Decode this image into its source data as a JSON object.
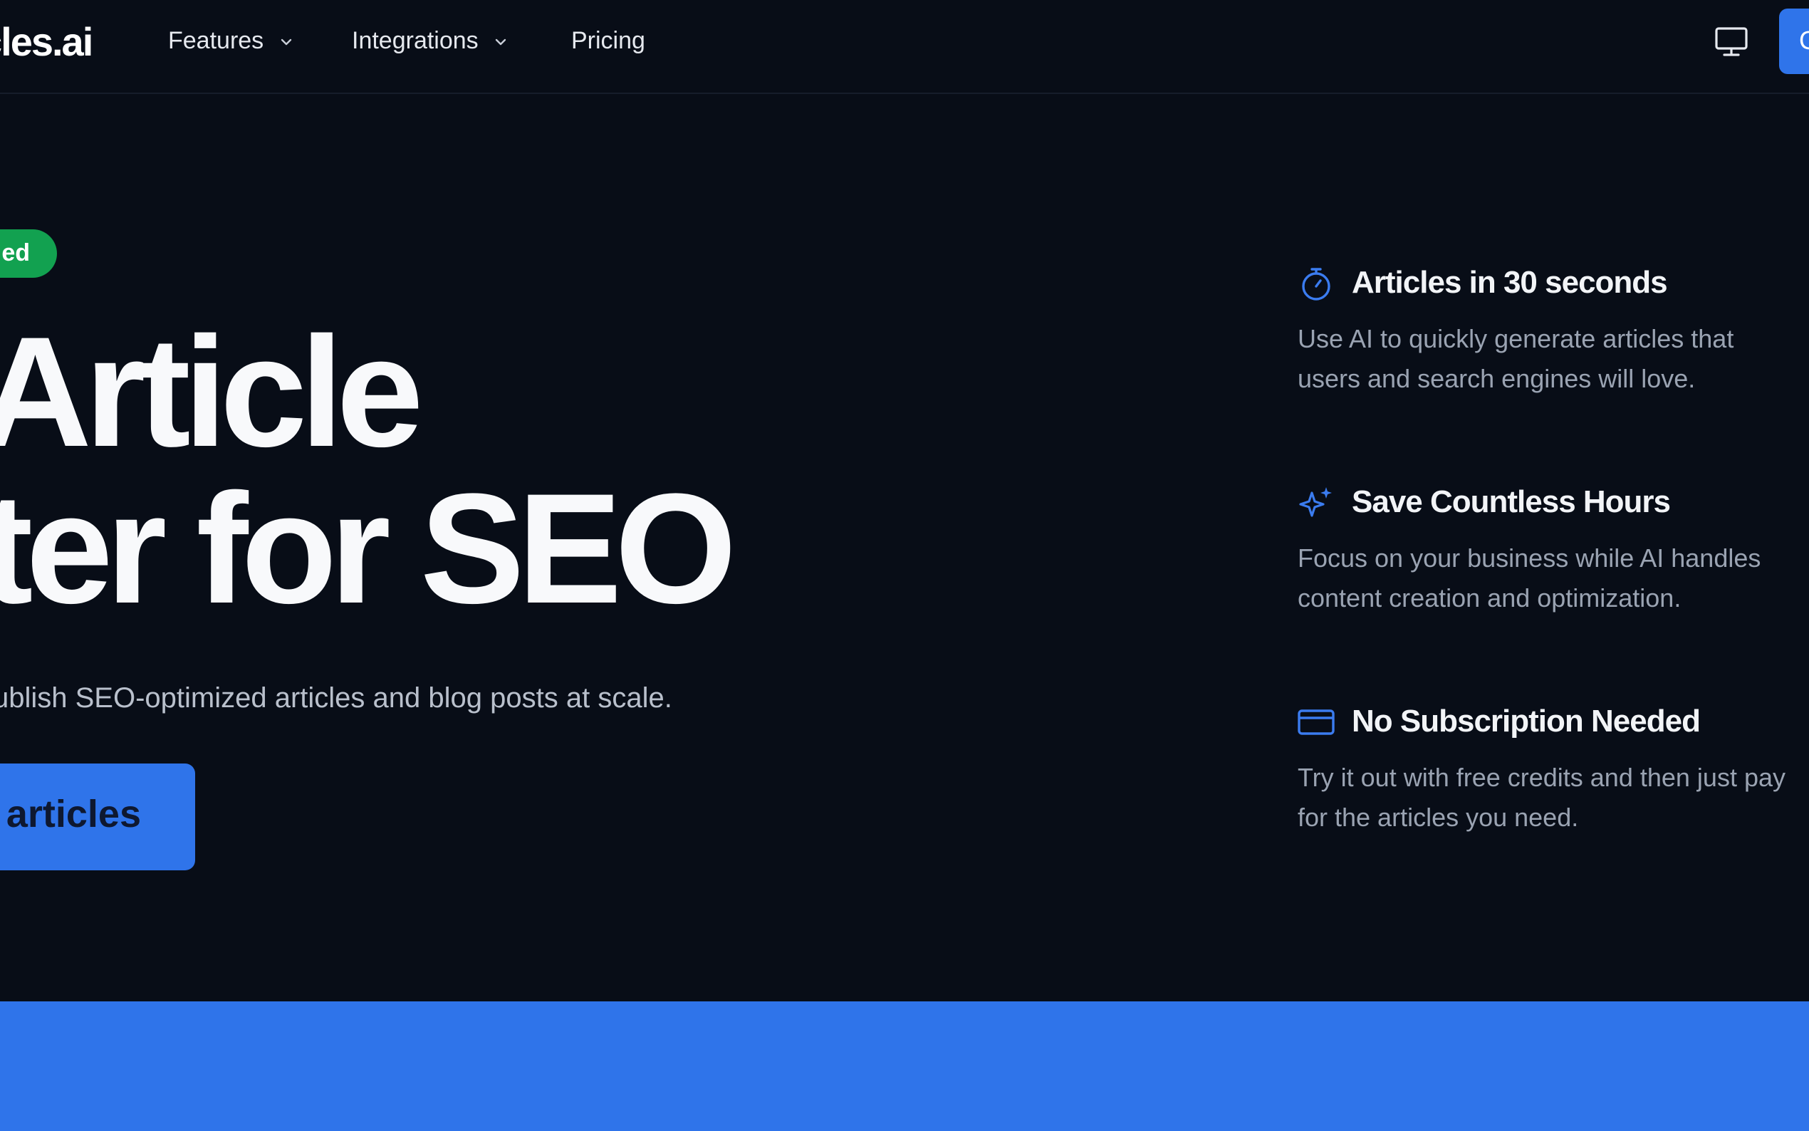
{
  "nav": {
    "logo": "cles.ai",
    "features_label": "Features",
    "integrations_label": "Integrations",
    "pricing_label": "Pricing",
    "cta_label": "G",
    "icons": [
      "chevron-down-icon",
      "monitor-icon"
    ]
  },
  "hero": {
    "badge": "ed",
    "title_line1": "Article",
    "title_line2": "iter for SEO",
    "subtitle": "ublish SEO-optimized articles and blog posts at scale.",
    "cta_label": "articles"
  },
  "features": [
    {
      "icon": "stopwatch-icon",
      "title": "Articles in 30 seconds",
      "description": "Use AI to quickly generate articles that users and search engines will love."
    },
    {
      "icon": "sparkles-icon",
      "title": "Save Countless Hours",
      "description": "Focus on your business while AI handles content creation and optimization."
    },
    {
      "icon": "credit-card-icon",
      "title": "No Subscription Needed",
      "description": "Try it out with free credits and then just pay for the articles you need."
    }
  ],
  "colors": {
    "background": "#080d17",
    "accent": "#2f74ea",
    "badge": "#12a150",
    "icon": "#3b7cf0"
  }
}
